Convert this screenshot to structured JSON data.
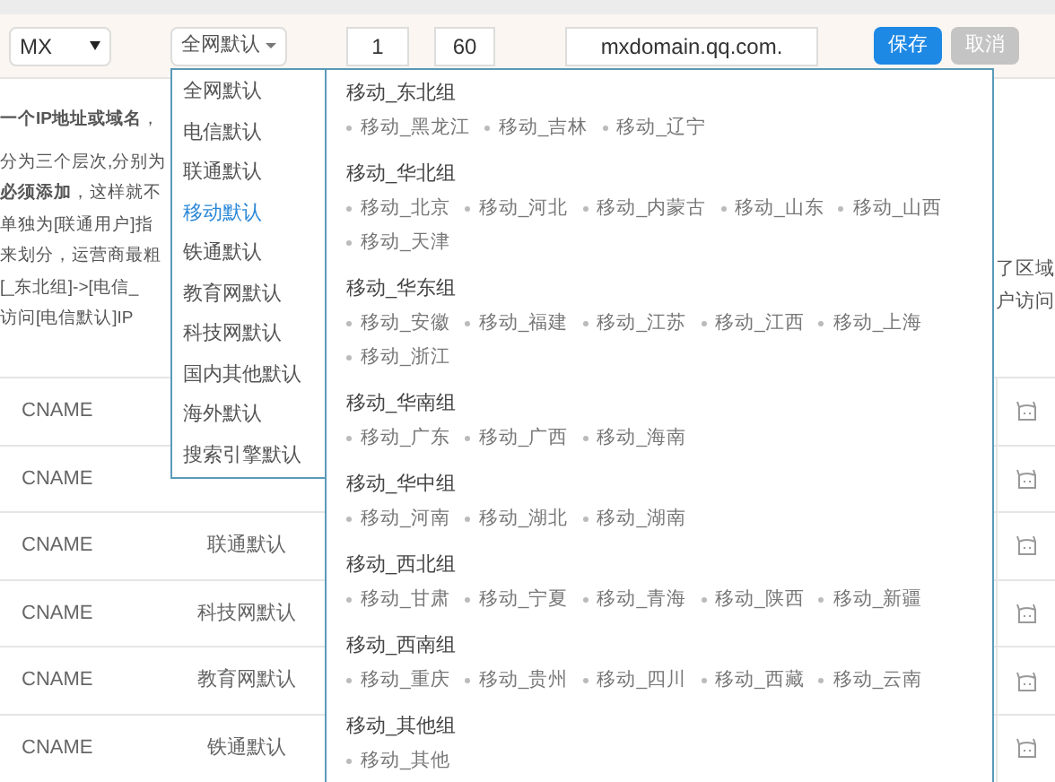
{
  "record_type_select": {
    "value": "MX"
  },
  "line_select": {
    "value": "全网默认"
  },
  "priority_input": {
    "value": "1"
  },
  "ttl_input": {
    "value": "60"
  },
  "value_input": {
    "value": "mxdomain.qq.com."
  },
  "buttons": [
    {
      "label": "保存",
      "kind": "primary"
    },
    {
      "label": "取消",
      "kind": "disabled"
    }
  ],
  "help_text": {
    "left_lines": [
      "**一个IP地址或域名**，",
      "分为三个层次,分别为",
      "**必须添加**，这样就不",
      "单独为[联通用户]指",
      "来划分，运营商最粗",
      "[_东北组]->[电信_",
      "访问[电信默认]IP"
    ],
    "right_lines": [
      "了区域",
      "户访问"
    ]
  },
  "table": {
    "rows": [
      {
        "type": "CNAME"
      },
      {
        "type": "CNAME"
      },
      {
        "type": "CNAME",
        "line": "联通默认"
      },
      {
        "type": "CNAME",
        "line": "科技网默认"
      },
      {
        "type": "CNAME",
        "line": "教育网默认"
      },
      {
        "type": "CNAME",
        "line": "铁通默认"
      }
    ]
  },
  "line_menu": {
    "items": [
      {
        "label": "全网默认",
        "selected": false
      },
      {
        "label": "电信默认",
        "selected": false
      },
      {
        "label": "联通默认",
        "selected": false
      },
      {
        "label": "移动默认",
        "selected": true
      },
      {
        "label": "铁通默认",
        "selected": false
      },
      {
        "label": "教育网默认",
        "selected": false
      },
      {
        "label": "科技网默认",
        "selected": false
      },
      {
        "label": "国内其他默认",
        "selected": false
      },
      {
        "label": "海外默认",
        "selected": false
      },
      {
        "label": "搜索引擎默认",
        "selected": false
      }
    ],
    "groups": [
      {
        "title": "移动_东北组",
        "items": [
          "移动_黑龙江",
          "移动_吉林",
          "移动_辽宁"
        ]
      },
      {
        "title": "移动_华北组",
        "items": [
          "移动_北京",
          "移动_河北",
          "移动_内蒙古",
          "移动_山东",
          "移动_山西",
          "移动_天津"
        ]
      },
      {
        "title": "移动_华东组",
        "items": [
          "移动_安徽",
          "移动_福建",
          "移动_江苏",
          "移动_江西",
          "移动_上海",
          "移动_浙江"
        ]
      },
      {
        "title": "移动_华南组",
        "items": [
          "移动_广东",
          "移动_广西",
          "移动_海南"
        ]
      },
      {
        "title": "移动_华中组",
        "items": [
          "移动_河南",
          "移动_湖北",
          "移动_湖南"
        ]
      },
      {
        "title": "移动_西北组",
        "items": [
          "移动_甘肃",
          "移动_宁夏",
          "移动_青海",
          "移动_陕西",
          "移动_新疆"
        ]
      },
      {
        "title": "移动_西南组",
        "items": [
          "移动_重庆",
          "移动_贵州",
          "移动_四川",
          "移动_西藏",
          "移动_云南"
        ]
      },
      {
        "title": "移动_其他组",
        "items": [
          "移动_其他"
        ]
      }
    ]
  }
}
